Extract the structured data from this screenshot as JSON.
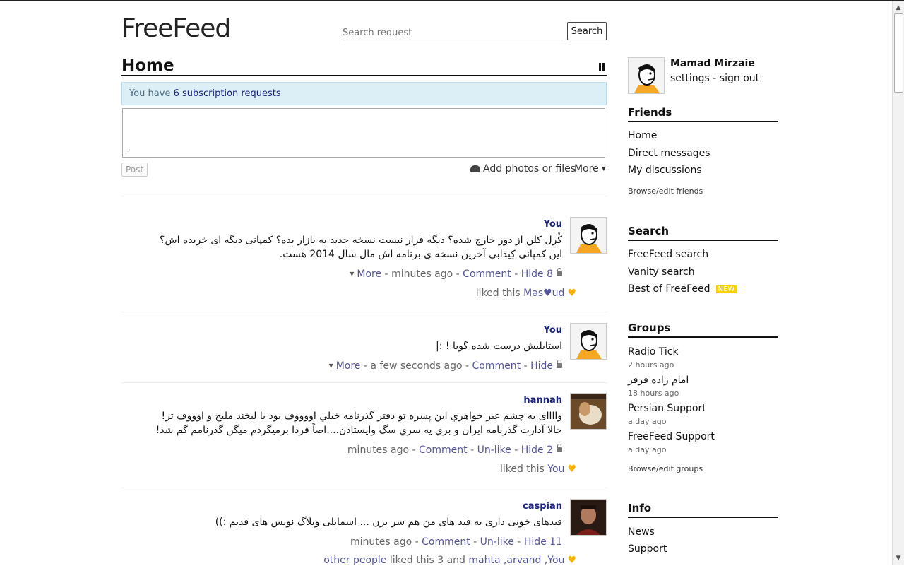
{
  "header": {
    "logo": "FreeFeed",
    "search_placeholder": "Search request",
    "search_button": "Search"
  },
  "home": {
    "title": "Home",
    "sub_prefix": "You have ",
    "sub_link": "6 subscription requests",
    "post_button": "Post",
    "add_photos": "Add photos or files",
    "more": "More"
  },
  "posts": [
    {
      "author": "You",
      "lines": [
        "کُرل کلن از دور خارج شده؟ دیگه قرار نیست نسخه جدید به بازار بده؟ کمپانی دیگه ای خریده اش؟",
        "این کمپانی کِیدابی آخرین نسخه ی برنامه اش مال سال 2014 هست."
      ],
      "more": "More",
      "time": "minutes ago",
      "comment": "Comment",
      "hide": "Hide 8",
      "likes_prefix": "liked this ",
      "likers": "Məs♥ud"
    },
    {
      "author": "You",
      "lines": [
        "استایلیش درست شده گویا ! :|"
      ],
      "more": "More",
      "time": "a few seconds ago",
      "comment": "Comment",
      "hide": "Hide"
    },
    {
      "author": "hannah",
      "lines": [
        "واااای به چشم غیر خواهري این پسره تو دفتر گذرنامه خیلي اووووف بود با لبخند ملیح و اوووف تر!",
        "حالا آدارت گذرنامه ایران و بري یه سري سگ وایستادن....اصاً فردا برمیگردم میگن گذرنامم گم شد!"
      ],
      "time": "minutes ago",
      "comment": "Comment",
      "unlike": "Un-like",
      "hide": "Hide 2",
      "likes_prefix": "liked this ",
      "likers": "You"
    },
    {
      "author": "caspian",
      "lines": [
        "فیدهای خوبی داری به فید های من هم سر بزن ... اسمایلی وبلاگ نویس های قدیم :))"
      ],
      "time": "minutes ago",
      "comment": "Comment",
      "unlike": "Un-like",
      "hide": "Hide 11",
      "likes_others": "other people",
      "likes_mid": " liked this 3 and ",
      "likers": "mahta ,arvand ,You"
    }
  ],
  "sidebar": {
    "user_name": "Mamad Mirzaie",
    "settings": "settings",
    "dash": " - ",
    "sign_out": "sign out",
    "friends": {
      "title": "Friends",
      "items": [
        "Home",
        "Direct messages",
        "My discussions"
      ],
      "browse": "Browse/edit friends"
    },
    "search": {
      "title": "Search",
      "items": [
        "FreeFeed search",
        "Vanity search",
        "Best of FreeFeed"
      ],
      "new_badge": "NEW"
    },
    "groups": {
      "title": "Groups",
      "items": [
        {
          "name": "Radio Tick",
          "time": "2 hours ago"
        },
        {
          "name": "امام زاده فرفر",
          "time": "18 hours ago"
        },
        {
          "name": "Persian Support",
          "time": "a day ago"
        },
        {
          "name": "FreeFeed Support",
          "time": "a day ago"
        }
      ],
      "browse": "Browse/edit groups"
    },
    "info": {
      "title": "Info",
      "items": [
        "News",
        "Support"
      ]
    }
  },
  "colors": {
    "link": "#555599",
    "author": "#1a237e",
    "sub_bg": "#dceef6",
    "heart": "#f4b400",
    "new_badge": "#f5d200"
  }
}
